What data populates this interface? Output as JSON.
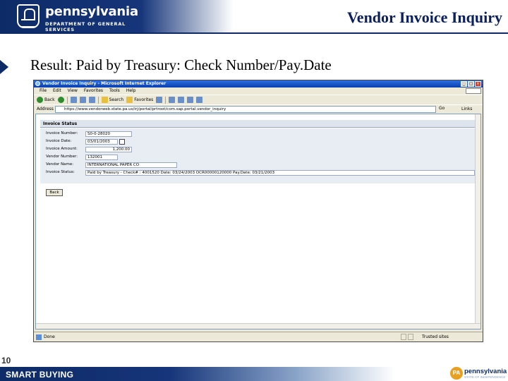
{
  "header": {
    "logo_text": "pennsylvania",
    "logo_subtext": "DEPARTMENT OF GENERAL SERVICES",
    "title": "Vendor Invoice Inquiry"
  },
  "subtitle": "Result:  Paid by Treasury:  Check Number/Pay.Date",
  "browser": {
    "window_title": "Vendor Invoice Inquiry - Microsoft Internet Explorer",
    "menu": [
      "File",
      "Edit",
      "View",
      "Favorites",
      "Tools",
      "Help"
    ],
    "toolbar": {
      "back_label": "Back",
      "search_label": "Search",
      "favorites_label": "Favorites"
    },
    "address_label": "Address",
    "address_value": "https://www.vendorweb.state.pa.us/irj/portal/prtroot/com.sap.portal.vendor_inquiry",
    "go_label": "Go",
    "links_label": "Links",
    "status_text": "Done",
    "status_zone": "Trusted sites"
  },
  "invoice_status": {
    "section_title": "Invoice Status",
    "fields": [
      {
        "label": "Invoice Number:",
        "value": "S0-0-28020"
      },
      {
        "label": "Invoice Date:",
        "value": "03/01/2003"
      },
      {
        "label": "Invoice Amount:",
        "value": "1,200.00"
      },
      {
        "label": "Vendor Number:",
        "value": "132001"
      },
      {
        "label": "Vendor Name:",
        "value": "INTERNATIONAL PAPER CO"
      },
      {
        "label": "Invoice Status:",
        "value": "Paid by Treasury - Check# : 4001520 Date: 03/24/2003 OCR00000120000 Pay.Date: 03/21/2003"
      }
    ],
    "back_button": "Back"
  },
  "footer": {
    "page_number": "10",
    "smart_buying": "SMART BUYING",
    "pa_logo_name": "pennsylvania",
    "pa_logo_mark": "PA",
    "pa_logo_tagline": "STATE OF INDEPENDENCE"
  }
}
